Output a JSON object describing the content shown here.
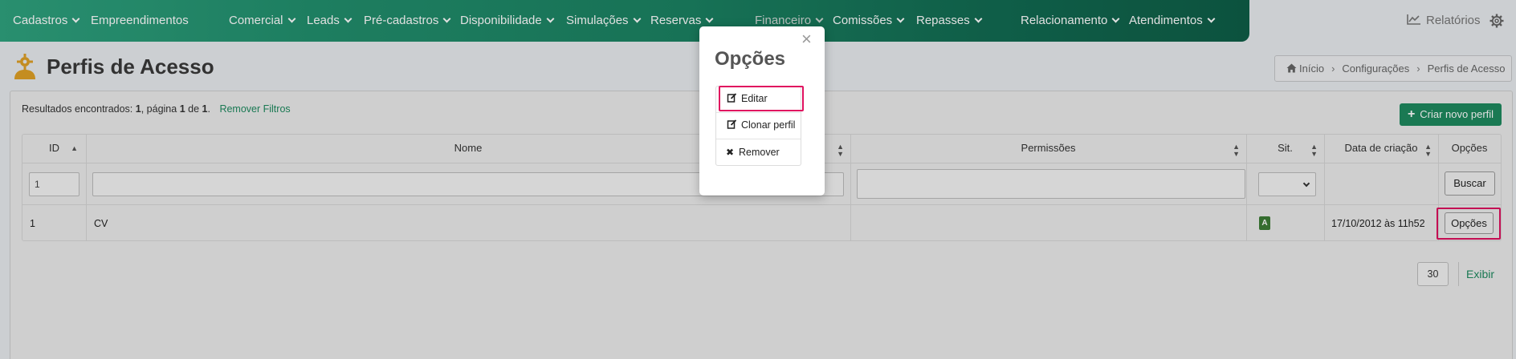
{
  "nav": {
    "items": [
      {
        "label": "Cadastros",
        "dropdown": true
      },
      {
        "label": "Empreendimentos",
        "dropdown": false
      },
      {
        "label": "Comercial",
        "dropdown": true
      },
      {
        "label": "Leads",
        "dropdown": true
      },
      {
        "label": "Pré-cadastros",
        "dropdown": true
      },
      {
        "label": "Disponibilidade",
        "dropdown": true
      },
      {
        "label": "Simulações",
        "dropdown": true
      },
      {
        "label": "Reservas",
        "dropdown": true
      },
      {
        "label": "Financeiro",
        "dropdown": true
      },
      {
        "label": "Comissões",
        "dropdown": true
      },
      {
        "label": "Repasses",
        "dropdown": true
      },
      {
        "label": "Relacionamento",
        "dropdown": true
      },
      {
        "label": "Atendimentos",
        "dropdown": true
      }
    ],
    "reports_label": "Relatórios",
    "brand_color": "#1e8a5f"
  },
  "page": {
    "title": "Perfis de Acesso",
    "breadcrumb": [
      "Início",
      "Configurações",
      "Perfis de Acesso"
    ]
  },
  "results": {
    "prefix": "Resultados encontrados:",
    "count": "1",
    "page_word": ", página",
    "page": "1",
    "of_word": "de",
    "total_pages": "1",
    "suffix": ".",
    "remove_filters": "Remover Filtros"
  },
  "create_button": "Criar novo perfil",
  "table": {
    "headers": {
      "id": "ID",
      "name": "Nome",
      "permissions": "Permissões",
      "status": "Sit.",
      "created": "Data de criação",
      "options": "Opções"
    },
    "filters": {
      "id_value": "1",
      "name_value": "",
      "permissions_value": "",
      "status_value": "",
      "search_button": "Buscar"
    },
    "rows": [
      {
        "id": "1",
        "name": "CV",
        "permissions": "",
        "status": "A",
        "created": "17/10/2012 às 11h52",
        "options_button": "Opções"
      }
    ]
  },
  "pagination": {
    "per_page": "30",
    "show_button": "Exibir"
  },
  "modal": {
    "title": "Opções",
    "close_symbol": "×",
    "items": [
      "Editar",
      "Clonar perfil",
      "Remover"
    ]
  },
  "highlight_color": "#e0115f"
}
